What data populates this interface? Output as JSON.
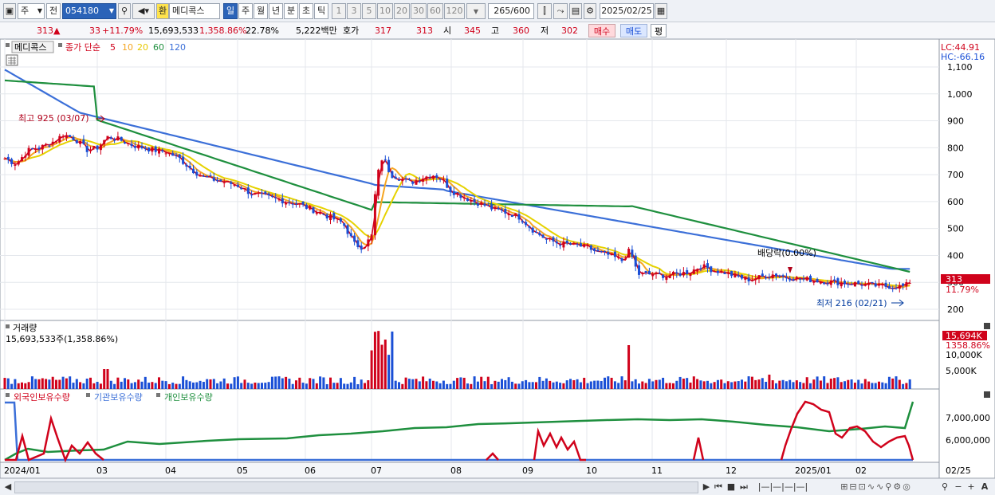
{
  "toolbar": {
    "market": "주",
    "period_prefix": "전",
    "stock_code": "054180",
    "currency_badge": "환",
    "stock_name": "메디콕스",
    "period_tabs": [
      "일",
      "주",
      "월",
      "년",
      "분",
      "초",
      "틱"
    ],
    "active_tab": "일",
    "interval_buttons": [
      "1",
      "3",
      "5",
      "10",
      "20",
      "30",
      "60",
      "120"
    ],
    "count": "265",
    "count_total": "/600",
    "date": "2025/02/25",
    "icons": [
      "chart-type-icon",
      "search-icon",
      "sound-icon",
      "candle-icon",
      "indicator-icon",
      "save-icon",
      "print-icon",
      "settings-icon",
      "calendar-icon"
    ]
  },
  "quote": {
    "price": "313",
    "change_arrow": "▲",
    "change": "33",
    "change_pct": "+11.79%",
    "volume": "15,693,533",
    "volume_pct": "1,358.86%",
    "turnover": "22.78%",
    "amount": "5,222백만",
    "bid_label": "호가",
    "bid1": "317",
    "bid2": "313",
    "open_label": "시",
    "open": "345",
    "high_label": "고",
    "high": "360",
    "low_label": "저",
    "low": "302",
    "buy_label": "매수",
    "sell_label": "매도",
    "eval_label": "평"
  },
  "price_panel": {
    "stock_tag": "메디콕스",
    "legend_prefix": "종가 단순",
    "ma_labels": [
      {
        "label": "5",
        "color": "#d0021b"
      },
      {
        "label": "10",
        "color": "#f5a623"
      },
      {
        "label": "20",
        "color": "#e6d200"
      },
      {
        "label": "60",
        "color": "#1e8f3e"
      },
      {
        "label": "120",
        "color": "#3b6fd8"
      }
    ],
    "lc_label": "LC:44.91",
    "hc_label": "HC:-66.16",
    "y_ticks": [
      "1,100",
      "1,000",
      "900",
      "800",
      "700",
      "600",
      "500",
      "400",
      "300",
      "200"
    ],
    "high_marker": "최고 925 (03/07)",
    "low_marker": "최저 216 (02/21)",
    "dividend_marker": "배당락(0.00%)",
    "current_price_tag": "313",
    "current_change_tag": "11.79%"
  },
  "volume_panel": {
    "title": "거래량",
    "current": "15,693,533주(1,358.86%)",
    "y_ticks": [
      "10,000K",
      "5,000K"
    ],
    "current_tag": "15,694K",
    "current_pct_tag": "1358.86%"
  },
  "holdings_panel": {
    "legends": [
      {
        "label": "외국인보유수량",
        "color": "#d0021b"
      },
      {
        "label": "기관보유수량",
        "color": "#3b6fd8"
      },
      {
        "label": "개인보유수량",
        "color": "#1e8f3e"
      }
    ],
    "y_ticks": [
      "7,000,000",
      "6,000,000"
    ]
  },
  "x_axis": {
    "labels": [
      "2024/01",
      "03",
      "04",
      "05",
      "06",
      "07",
      "08",
      "09",
      "10",
      "11",
      "12",
      "2025/01",
      "02"
    ],
    "right_label": "02/25"
  },
  "colors": {
    "up": "#d0021b",
    "down": "#1a4fd6",
    "ma5": "#d0021b",
    "ma10": "#f5a623",
    "ma20": "#e6d200",
    "ma60": "#1e8f3e",
    "ma120": "#3b6fd8",
    "accent": "#2b63b8"
  }
}
